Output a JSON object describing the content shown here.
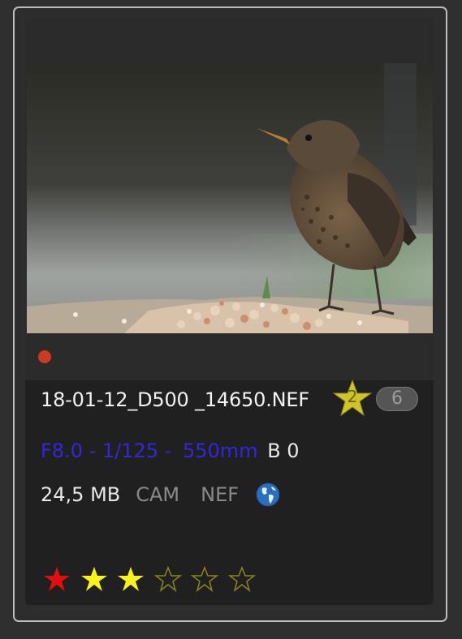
{
  "file": {
    "name": "18-01-12_D500 _14650.NEF",
    "badge_number": "2",
    "version_count": "6"
  },
  "exif": {
    "aperture_shutter": "F8.0 - 1/125 - ",
    "focal_length": "550mm",
    "extra": "B 0"
  },
  "fileinfo": {
    "size": "24,5 MB",
    "tag_cam": "CAM",
    "tag_format": "NEF"
  },
  "rating": {
    "filled": 2,
    "total": 5
  },
  "colors": {
    "label_red": "#cc3a1f",
    "exif_blue": "#3327d8",
    "star_yellow": "#f6f21a",
    "reject_red": "#e01010",
    "badge_gold": "#cfc52a"
  },
  "icons": {
    "label": "color-label-dot",
    "badge": "star-badge-icon",
    "geo": "globe-icon",
    "reject": "reject-star-icon",
    "rating": "rating-star-icon"
  }
}
